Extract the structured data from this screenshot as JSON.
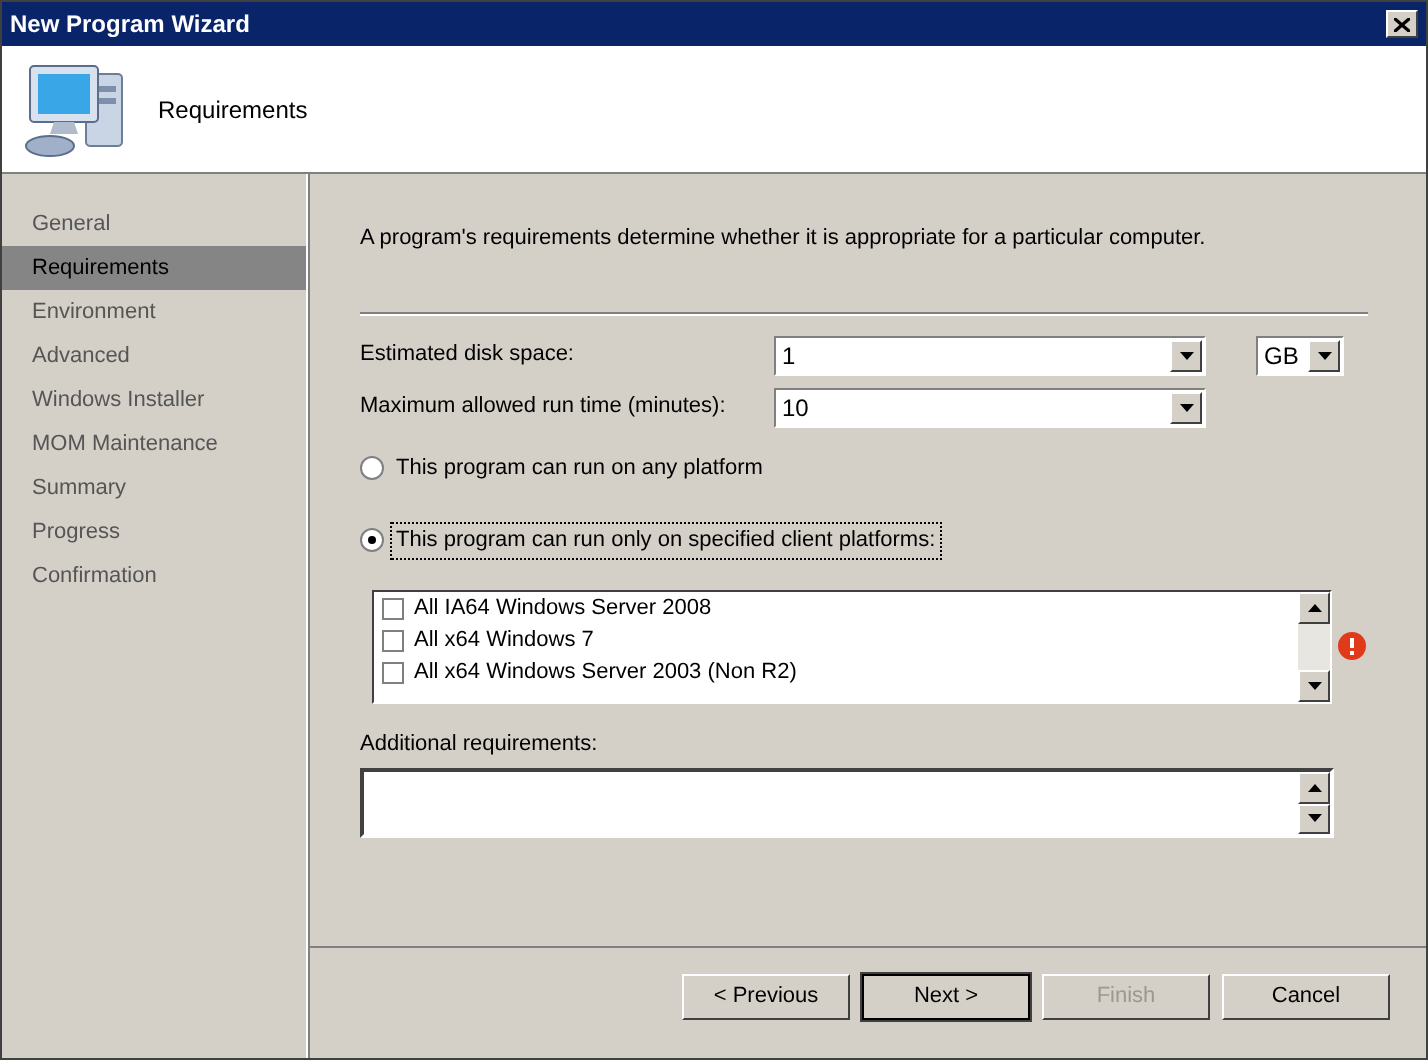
{
  "window": {
    "title": "New Program Wizard"
  },
  "header": {
    "title": "Requirements"
  },
  "steps": [
    {
      "label": "General",
      "selected": false
    },
    {
      "label": "Requirements",
      "selected": true
    },
    {
      "label": "Environment",
      "selected": false
    },
    {
      "label": "Advanced",
      "selected": false
    },
    {
      "label": "Windows Installer",
      "selected": false
    },
    {
      "label": "MOM Maintenance",
      "selected": false
    },
    {
      "label": "Summary",
      "selected": false
    },
    {
      "label": "Progress",
      "selected": false
    },
    {
      "label": "Confirmation",
      "selected": false
    }
  ],
  "description": "A program's requirements determine whether it is appropriate for a particular computer.",
  "disk_space": {
    "label": "Estimated disk space:",
    "value": "1",
    "unit": "GB"
  },
  "run_time": {
    "label": "Maximum allowed run time (minutes):",
    "value": "10"
  },
  "platform_options": [
    {
      "label": "This program can run on any platform",
      "selected": false
    },
    {
      "label": "This program can run only on specified client platforms:",
      "selected": true
    }
  ],
  "platform_list": {
    "error": true,
    "items": [
      {
        "label": "All IA64 Windows Server 2008",
        "checked": false
      },
      {
        "label": "All x64 Windows 7",
        "checked": false
      },
      {
        "label": "All x64 Windows Server 2003 (Non R2)",
        "checked": false
      }
    ]
  },
  "additional": {
    "label": "Additional requirements:"
  },
  "buttons": [
    {
      "label": "< Previous",
      "disabled": false,
      "default": false
    },
    {
      "label": "Next >",
      "disabled": false,
      "default": true
    },
    {
      "label": "Finish",
      "disabled": true,
      "default": false
    },
    {
      "label": "Cancel",
      "disabled": false,
      "default": false
    }
  ]
}
